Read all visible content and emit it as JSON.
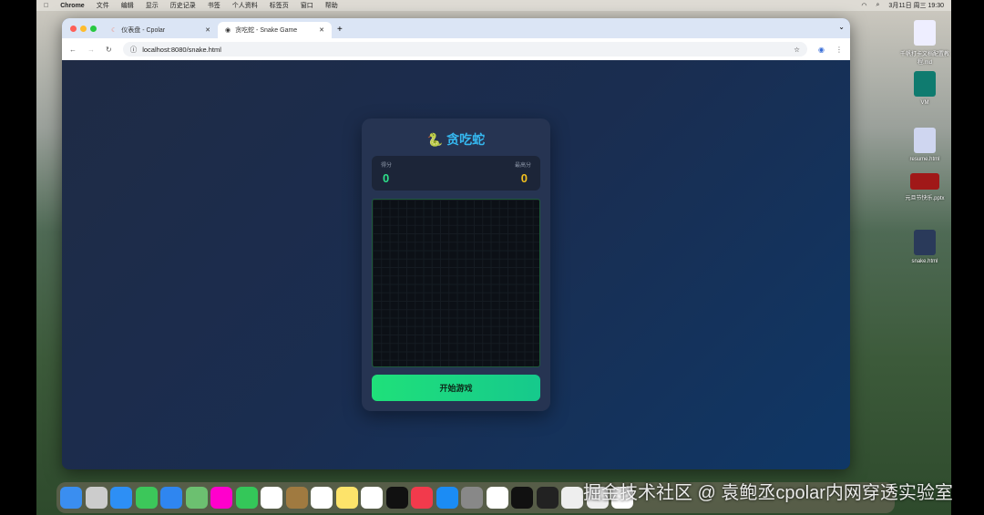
{
  "menubar": {
    "app": "Chrome",
    "items": [
      "文件",
      "编辑",
      "显示",
      "历史记录",
      "书签",
      "个人资料",
      "标签页",
      "窗口",
      "帮助"
    ],
    "clock": "3月11日 周三 19:30"
  },
  "browser": {
    "tabs": [
      {
        "title": "仪表盘 - Cpolar"
      },
      {
        "title": "贪吃蛇 - Snake Game"
      }
    ],
    "url": "localhost:8080/snake.html"
  },
  "game": {
    "title": "贪吃蛇",
    "score_label": "得分",
    "score": "0",
    "high_label": "最高分",
    "high": "0",
    "start_label": "开始游戏"
  },
  "desktop": {
    "files": [
      "千帆打卡文档配置教程.md",
      "VM",
      "resume.html",
      "元旦节快乐.pptx",
      "snake.html"
    ]
  },
  "watermark": "掘金技术社区 @ 袁鲍丞cpolar内网穿透实验室",
  "colors": {
    "accent": "#35b8f0",
    "score": "#2ee08a",
    "high": "#f2c01e",
    "button": "#1fe07a"
  }
}
